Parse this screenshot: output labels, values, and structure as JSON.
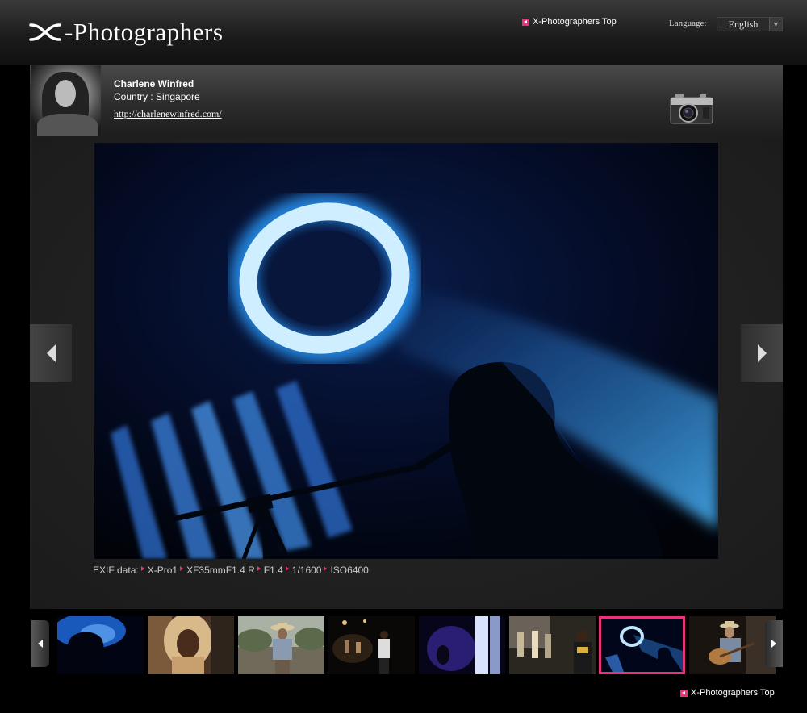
{
  "header": {
    "logo_text": "-Photographers",
    "top_link": "X-Photographers Top",
    "language_label": "Language:",
    "language_value": "English"
  },
  "photographer": {
    "name": "Charlene Winfred",
    "country": "Country : Singapore",
    "url": "http://charlenewinfred.com/"
  },
  "exif": {
    "label": "EXIF data:",
    "camera": "X-Pro1",
    "lens": "XF35mmF1.4 R",
    "aperture": "F1.4",
    "shutter": "1/1600",
    "iso": "ISO6400"
  },
  "thumbnails": [
    {
      "name": "thumb-blue-silhouette",
      "active": false
    },
    {
      "name": "thumb-woman-braids",
      "active": false
    },
    {
      "name": "thumb-cowboy",
      "active": false
    },
    {
      "name": "thumb-night-street",
      "active": false
    },
    {
      "name": "thumb-purple-light",
      "active": false
    },
    {
      "name": "thumb-street-crowd",
      "active": false
    },
    {
      "name": "thumb-blue-ring-singer",
      "active": true
    },
    {
      "name": "thumb-guitarist",
      "active": false
    }
  ],
  "footer": {
    "top_link": "X-Photographers Top"
  },
  "colors": {
    "accent": "#e8327a",
    "background": "#000000"
  }
}
